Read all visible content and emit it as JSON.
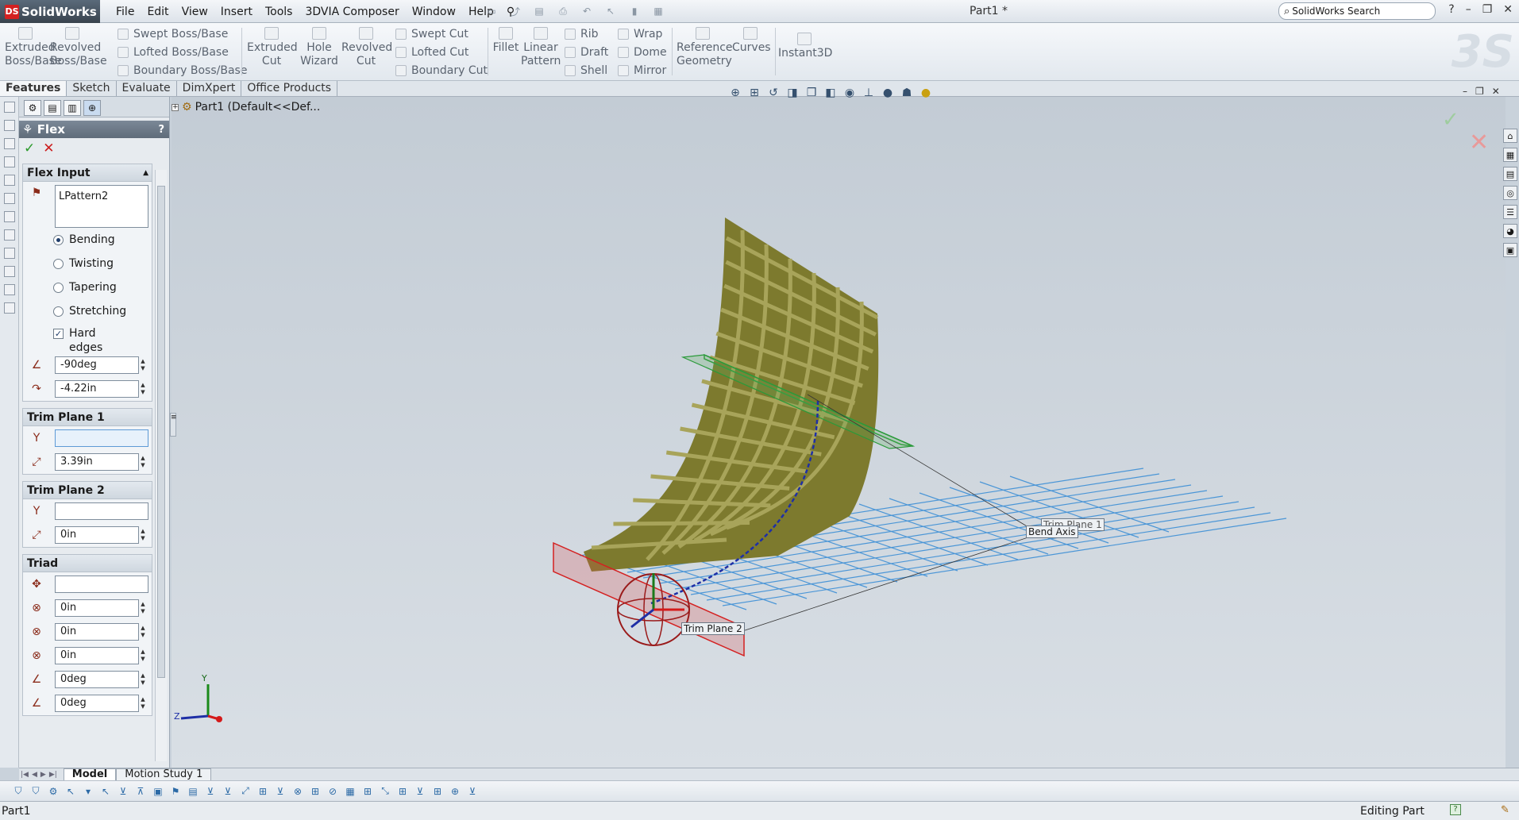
{
  "app": {
    "brand": "SolidWorks",
    "menus": [
      "File",
      "Edit",
      "View",
      "Insert",
      "Tools",
      "3DVIA Composer",
      "Window",
      "Help"
    ],
    "document_title": "Part1 *",
    "search_placeholder": "SolidWorks Search"
  },
  "commandmanager": {
    "extruded_boss": "Extruded\nBoss/Base",
    "revolved_boss": "Revolved\nBoss/Base",
    "swept_boss": "Swept Boss/Base",
    "lofted_boss": "Lofted Boss/Base",
    "boundary_boss": "Boundary Boss/Base",
    "extruded_cut": "Extruded\nCut",
    "hole_wizard": "Hole\nWizard",
    "revolved_cut": "Revolved\nCut",
    "swept_cut": "Swept Cut",
    "lofted_cut": "Lofted Cut",
    "boundary_cut": "Boundary Cut",
    "fillet": "Fillet",
    "linear_pattern": "Linear\nPattern",
    "rib": "Rib",
    "draft": "Draft",
    "shell": "Shell",
    "wrap": "Wrap",
    "dome": "Dome",
    "mirror": "Mirror",
    "reference_geometry": "Reference\nGeometry",
    "curves": "Curves",
    "instant3d": "Instant3D"
  },
  "tabs": [
    "Features",
    "Sketch",
    "Evaluate",
    "DimXpert",
    "Office Products"
  ],
  "tree": {
    "root_label": "Part1  (Default<<Def..."
  },
  "property_manager": {
    "title": "Flex",
    "help": "?",
    "flex_input": {
      "header": "Flex Input",
      "bodies": "LPattern2",
      "options": [
        {
          "label": "Bending",
          "selected": true
        },
        {
          "label": "Twisting",
          "selected": false
        },
        {
          "label": "Tapering",
          "selected": false
        },
        {
          "label": "Stretching",
          "selected": false
        }
      ],
      "hard_edges_label": "Hard\nedges",
      "hard_edges_checked": true,
      "angle": "-90deg",
      "radius": "-4.22in"
    },
    "trim_plane_1": {
      "header": "Trim Plane 1",
      "reference": "",
      "distance": "3.39in"
    },
    "trim_plane_2": {
      "header": "Trim Plane 2",
      "reference": "",
      "distance": "0in"
    },
    "triad": {
      "header": "Triad",
      "reference": "",
      "x": "0in",
      "y": "0in",
      "z": "0in",
      "rot_x": "0deg",
      "rot_y": "0deg"
    }
  },
  "viewport": {
    "label_trim_plane_1": "Trim Plane 1",
    "label_bend_axis": "Bend Axis",
    "label_trim_plane_2": "Trim Plane 2",
    "axis_y": "Y",
    "axis_z": "Z"
  },
  "bottom_tabs": [
    "Model",
    "Motion Study 1"
  ],
  "status": {
    "left": "Part1",
    "right": "Editing Part"
  },
  "colors": {
    "body": "#7d7a2e",
    "mesh": "#3d8fd6",
    "trim_plane_1": "#2a9a3a",
    "trim_plane_2": "#d42020",
    "bend_axis_curve": "#1e2fa6"
  }
}
